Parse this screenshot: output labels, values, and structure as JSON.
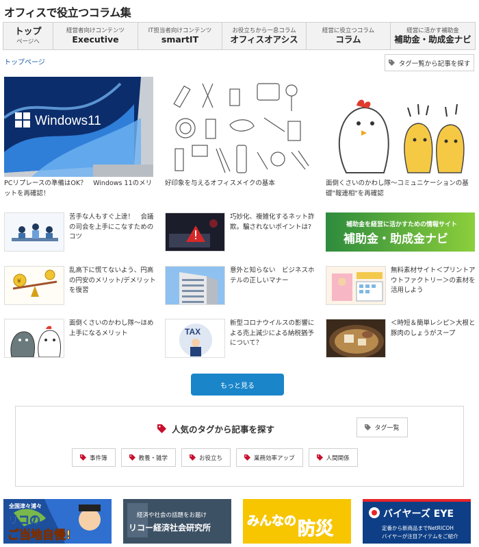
{
  "site": {
    "title": "オフィスで役立つコラム集"
  },
  "nav": [
    {
      "sub": "ページへ",
      "main": "トップ"
    },
    {
      "sub": "経営者向けコンテンツ",
      "main": "Executive"
    },
    {
      "sub": "IT担当者向けコンテンツ",
      "main": "smartIT"
    },
    {
      "sub": "お役立ちから一息コラム",
      "main": "オフィスオアシス"
    },
    {
      "sub": "経営に役立つコラム",
      "main": "コラム"
    },
    {
      "sub": "経営に活かす補助金",
      "main": "補助金・助成金ナビ"
    }
  ],
  "breadcrumb": "トップページ",
  "tag_list_button": "タグ一覧から記事を探す",
  "featured": [
    {
      "caption": "PCリプレースの準備はOK？　Windows 11のメリットを再確認！",
      "thumb_text": "Windows11"
    },
    {
      "caption": "好印象を与えるオフィスメイクの基本"
    },
    {
      "caption": "面倒くさいのかわし隊～コミュニケーションの基礎\"報連相\"を再確認"
    }
  ],
  "articles": [
    {
      "caption": "苦手な人もすぐ上達！　会議の司会を上手にこなすためのコツ"
    },
    {
      "caption": "巧妙化、複雑化するネット詐欺。騙されないポイントは?"
    },
    {
      "caption": "",
      "thumb_sub": "補助金を経営に活かすための情報サイト",
      "thumb_main": "補助金・助成金ナビ"
    },
    {
      "caption": "乱高下に慌てないよう、円高の円安のメリット/デメリットを復習"
    },
    {
      "caption": "意外と知らない　ビジネスホテルの正しいマナー"
    },
    {
      "caption": "無料素材サイト＜プリントアウトファクトリー＞の素材を活用しよう"
    },
    {
      "caption": "面倒くさいのかわし隊～ほめ上手になるメリット"
    },
    {
      "caption": "新型コロナウイルスの影響による売上減少による納税猶予について？",
      "thumb_text": "TAX"
    },
    {
      "caption": "＜時短＆簡単レシピ＞大根と豚肉のしょうがスープ"
    }
  ],
  "more_button": "もっと見る",
  "tag_panel": {
    "heading": "人気のタグから記事を探す",
    "button": "タグ一覧",
    "tags": [
      "事件簿",
      "教養・雑学",
      "お役立ち",
      "業務効率アップ",
      "人間関係"
    ]
  },
  "banners": [
    {
      "line1": "全国津々浦々",
      "line2": "リコの",
      "line3": "ご当地自慢!"
    },
    {
      "line1": "経済や社会の話題をお届け",
      "line2": "リコー経済社会研究所"
    },
    {
      "line1": "みんなの",
      "line2": "防災"
    },
    {
      "line1": "バイヤーズ EYE",
      "line2": "定番から新商品までNetRICOH",
      "line3": "バイヤーが注目アイテムをご紹介"
    }
  ],
  "colors": {
    "accent": "#1a85c9",
    "link": "#1a5fa6",
    "tag_icon": "#c8102e",
    "nav_bg": "#f2f2f2"
  }
}
